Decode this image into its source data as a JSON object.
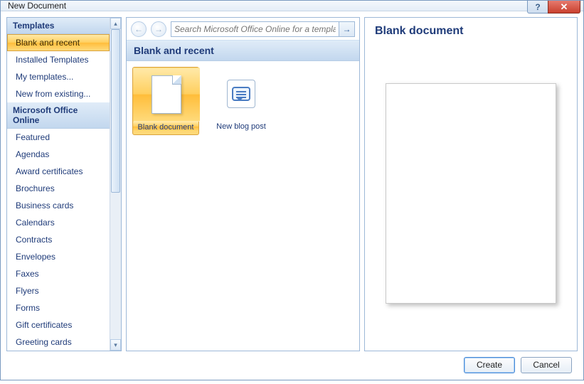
{
  "window": {
    "title": "New Document"
  },
  "sidebar": {
    "header1": "Templates",
    "items1": [
      {
        "label": "Blank and recent",
        "selected": true
      },
      {
        "label": "Installed Templates"
      },
      {
        "label": "My templates..."
      },
      {
        "label": "New from existing..."
      }
    ],
    "header2": "Microsoft Office Online",
    "items2": [
      {
        "label": "Featured"
      },
      {
        "label": "Agendas"
      },
      {
        "label": "Award certificates"
      },
      {
        "label": "Brochures"
      },
      {
        "label": "Business cards"
      },
      {
        "label": "Calendars"
      },
      {
        "label": "Contracts"
      },
      {
        "label": "Envelopes"
      },
      {
        "label": "Faxes"
      },
      {
        "label": "Flyers"
      },
      {
        "label": "Forms"
      },
      {
        "label": "Gift certificates"
      },
      {
        "label": "Greeting cards"
      }
    ]
  },
  "search": {
    "placeholder": "Search Microsoft Office Online for a template"
  },
  "main": {
    "section_title": "Blank and recent",
    "templates": [
      {
        "label": "Blank document",
        "icon": "doc",
        "selected": true
      },
      {
        "label": "New blog post",
        "icon": "blog"
      }
    ]
  },
  "preview": {
    "title": "Blank document"
  },
  "footer": {
    "create": "Create",
    "cancel": "Cancel"
  },
  "icons": {
    "help": "?",
    "close": "✕",
    "back": "←",
    "forward": "→",
    "go": "→",
    "up": "▴",
    "down": "▾"
  }
}
